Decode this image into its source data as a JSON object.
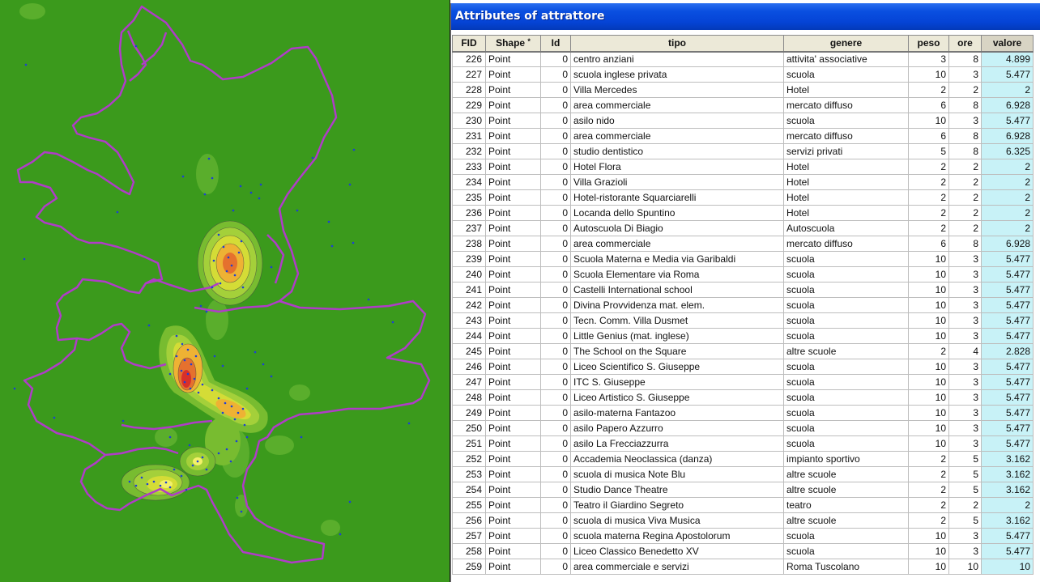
{
  "window": {
    "title": "Attributes of attrattore"
  },
  "table": {
    "columns": [
      {
        "key": "fid",
        "label": "FID"
      },
      {
        "key": "shape",
        "label": "Shape",
        "sort_marker": "*"
      },
      {
        "key": "id",
        "label": "Id"
      },
      {
        "key": "tipo",
        "label": "tipo"
      },
      {
        "key": "genere",
        "label": "genere"
      },
      {
        "key": "peso",
        "label": "peso"
      },
      {
        "key": "ore",
        "label": "ore"
      },
      {
        "key": "valore",
        "label": "valore"
      }
    ],
    "rows": [
      [
        "226",
        "Point",
        "0",
        "centro anziani",
        "attivita' associative",
        "3",
        "8",
        "4.899"
      ],
      [
        "227",
        "Point",
        "0",
        "scuola inglese privata",
        "scuola",
        "10",
        "3",
        "5.477"
      ],
      [
        "228",
        "Point",
        "0",
        "Villa Mercedes",
        "Hotel",
        "2",
        "2",
        "2"
      ],
      [
        "229",
        "Point",
        "0",
        "area commerciale",
        "mercato diffuso",
        "6",
        "8",
        "6.928"
      ],
      [
        "230",
        "Point",
        "0",
        "asilo nido",
        "scuola",
        "10",
        "3",
        "5.477"
      ],
      [
        "231",
        "Point",
        "0",
        "area commerciale",
        "mercato diffuso",
        "6",
        "8",
        "6.928"
      ],
      [
        "232",
        "Point",
        "0",
        "studio dentistico",
        "servizi privati",
        "5",
        "8",
        "6.325"
      ],
      [
        "233",
        "Point",
        "0",
        "Hotel Flora",
        "Hotel",
        "2",
        "2",
        "2"
      ],
      [
        "234",
        "Point",
        "0",
        "Villa Grazioli",
        "Hotel",
        "2",
        "2",
        "2"
      ],
      [
        "235",
        "Point",
        "0",
        "Hotel-ristorante Squarciarelli",
        "Hotel",
        "2",
        "2",
        "2"
      ],
      [
        "236",
        "Point",
        "0",
        "Locanda dello Spuntino",
        "Hotel",
        "2",
        "2",
        "2"
      ],
      [
        "237",
        "Point",
        "0",
        "Autoscuola Di Biagio",
        "Autoscuola",
        "2",
        "2",
        "2"
      ],
      [
        "238",
        "Point",
        "0",
        "area commerciale",
        "mercato diffuso",
        "6",
        "8",
        "6.928"
      ],
      [
        "239",
        "Point",
        "0",
        "Scuola Materna e Media via Garibaldi",
        "scuola",
        "10",
        "3",
        "5.477"
      ],
      [
        "240",
        "Point",
        "0",
        "Scuola Elementare via Roma",
        "scuola",
        "10",
        "3",
        "5.477"
      ],
      [
        "241",
        "Point",
        "0",
        "Castelli International school",
        "scuola",
        "10",
        "3",
        "5.477"
      ],
      [
        "242",
        "Point",
        "0",
        "Divina Provvidenza mat. elem.",
        "scuola",
        "10",
        "3",
        "5.477"
      ],
      [
        "243",
        "Point",
        "0",
        "Tecn. Comm. Villa Dusmet",
        "scuola",
        "10",
        "3",
        "5.477"
      ],
      [
        "244",
        "Point",
        "0",
        "Little Genius (mat. inglese)",
        "scuola",
        "10",
        "3",
        "5.477"
      ],
      [
        "245",
        "Point",
        "0",
        "The School on the Square",
        "altre scuole",
        "2",
        "4",
        "2.828"
      ],
      [
        "246",
        "Point",
        "0",
        "Liceo Scientifico S. Giuseppe",
        "scuola",
        "10",
        "3",
        "5.477"
      ],
      [
        "247",
        "Point",
        "0",
        "ITC S. Giuseppe",
        "scuola",
        "10",
        "3",
        "5.477"
      ],
      [
        "248",
        "Point",
        "0",
        "Liceo Artistico S. Giuseppe",
        "scuola",
        "10",
        "3",
        "5.477"
      ],
      [
        "249",
        "Point",
        "0",
        "asilo-materna Fantazoo",
        "scuola",
        "10",
        "3",
        "5.477"
      ],
      [
        "250",
        "Point",
        "0",
        "asilo Papero Azzurro",
        "scuola",
        "10",
        "3",
        "5.477"
      ],
      [
        "251",
        "Point",
        "0",
        "asilo La Frecciazzurra",
        "scuola",
        "10",
        "3",
        "5.477"
      ],
      [
        "252",
        "Point",
        "0",
        "Accademia Neoclassica (danza)",
        "impianto sportivo",
        "2",
        "5",
        "3.162"
      ],
      [
        "253",
        "Point",
        "0",
        "scuola di musica Note Blu",
        "altre scuole",
        "2",
        "5",
        "3.162"
      ],
      [
        "254",
        "Point",
        "0",
        "Studio Dance Theatre",
        "altre scuole",
        "2",
        "5",
        "3.162"
      ],
      [
        "255",
        "Point",
        "0",
        "Teatro il Giardino Segreto",
        "teatro",
        "2",
        "2",
        "2"
      ],
      [
        "256",
        "Point",
        "0",
        "scuola di musica Viva Musica",
        "altre scuole",
        "2",
        "5",
        "3.162"
      ],
      [
        "257",
        "Point",
        "0",
        "scuola materna Regina Apostolorum",
        "scuola",
        "10",
        "3",
        "5.477"
      ],
      [
        "258",
        "Point",
        "0",
        "Liceo Classico Benedetto XV",
        "scuola",
        "10",
        "3",
        "5.477"
      ],
      [
        "259",
        "Point",
        "0",
        "area commerciale e servizi",
        "Roma Tuscolano",
        "10",
        "10",
        "10"
      ]
    ]
  },
  "colors": {
    "map_background": "#3b9a1c",
    "boundary": "#b03cc8",
    "point": "#1d3fd6",
    "valore_highlight": "#c8f2f7",
    "titlebar": "#0a4fe0"
  }
}
